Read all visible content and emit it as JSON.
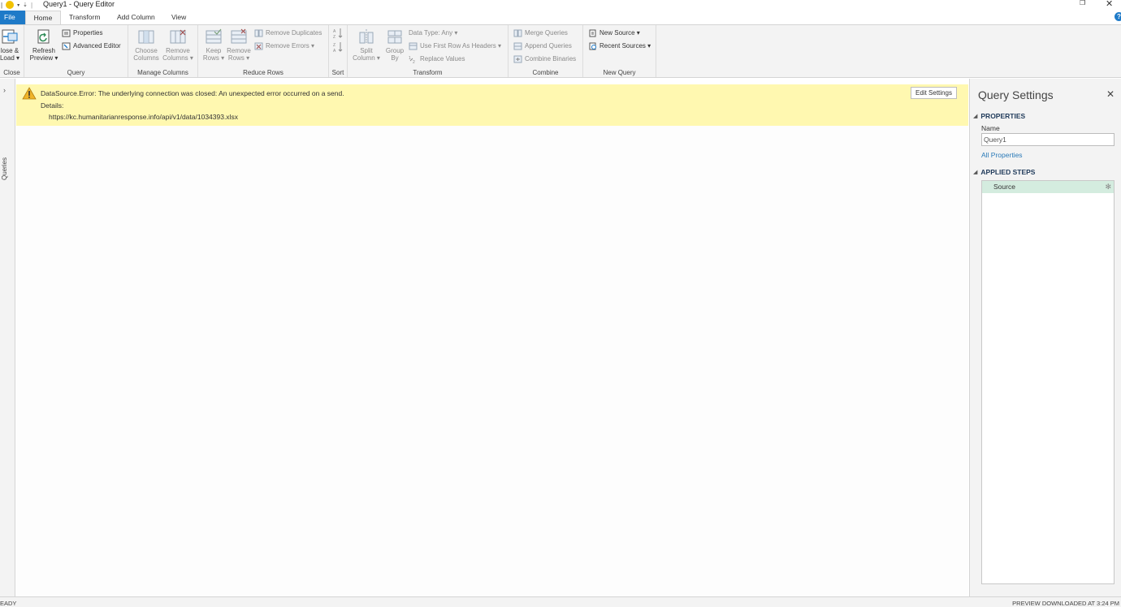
{
  "window": {
    "title": "Query1 - Query Editor",
    "qat_text": "⌐ |",
    "restore_glyph": "❐",
    "close_glyph": "✕"
  },
  "tabs": [
    {
      "label": "File"
    },
    {
      "label": "Home"
    },
    {
      "label": "Transform"
    },
    {
      "label": "Add Column"
    },
    {
      "label": "View"
    }
  ],
  "help_glyph": "?",
  "ribbon": {
    "close_group": {
      "label": "Close",
      "close_load_line1": "lose &",
      "close_load_line2": "Load ▾"
    },
    "query_group": {
      "label": "Query",
      "refresh_line1": "Refresh",
      "refresh_line2": "Preview ▾",
      "properties": "Properties",
      "advanced_editor": "Advanced Editor"
    },
    "manage_columns_group": {
      "label": "Manage Columns",
      "choose_line1": "Choose",
      "choose_line2": "Columns",
      "remove_line1": "Remove",
      "remove_line2": "Columns ▾"
    },
    "reduce_rows_group": {
      "label": "Reduce Rows",
      "keep_line1": "Keep",
      "keep_line2": "Rows ▾",
      "remove_line1": "Remove",
      "remove_line2": "Rows ▾",
      "remove_duplicates": "Remove Duplicates",
      "remove_errors": "Remove Errors ▾"
    },
    "sort_group": {
      "label": "Sort"
    },
    "transform_group": {
      "label": "Transform",
      "split_line1": "Split",
      "split_line2": "Column ▾",
      "group_line1": "Group",
      "group_line2": "By",
      "data_type": "Data Type: Any ▾",
      "first_row_headers": "Use First Row As Headers ▾",
      "replace_values": "Replace Values"
    },
    "combine_group": {
      "label": "Combine",
      "merge": "Merge Queries",
      "append": "Append Queries",
      "combine_binaries": "Combine Binaries"
    },
    "new_query_group": {
      "label": "New Query",
      "new_source": "New Source ▾",
      "recent_sources": "Recent Sources ▾"
    }
  },
  "queries_pane": {
    "label": "Queries",
    "chevron": "›"
  },
  "error": {
    "message": "DataSource.Error: The underlying connection was closed: An unexpected error occurred on a send.",
    "details_label": "Details:",
    "url": "https://kc.humanitarianresponse.info/api/v1/data/1034393.xlsx",
    "edit_settings": "Edit Settings"
  },
  "query_settings": {
    "title": "Query Settings",
    "close_glyph": "✕",
    "properties_heading": "PROPERTIES",
    "name_label": "Name",
    "name_value": "Query1",
    "all_properties": "All Properties",
    "applied_steps_heading": "APPLIED STEPS",
    "steps": [
      {
        "label": "Source"
      }
    ],
    "gear_glyph": "✻",
    "collapse_glyph": "◢"
  },
  "status": {
    "left": "EADY",
    "right": "PREVIEW DOWNLOADED AT 3:24 PM"
  }
}
